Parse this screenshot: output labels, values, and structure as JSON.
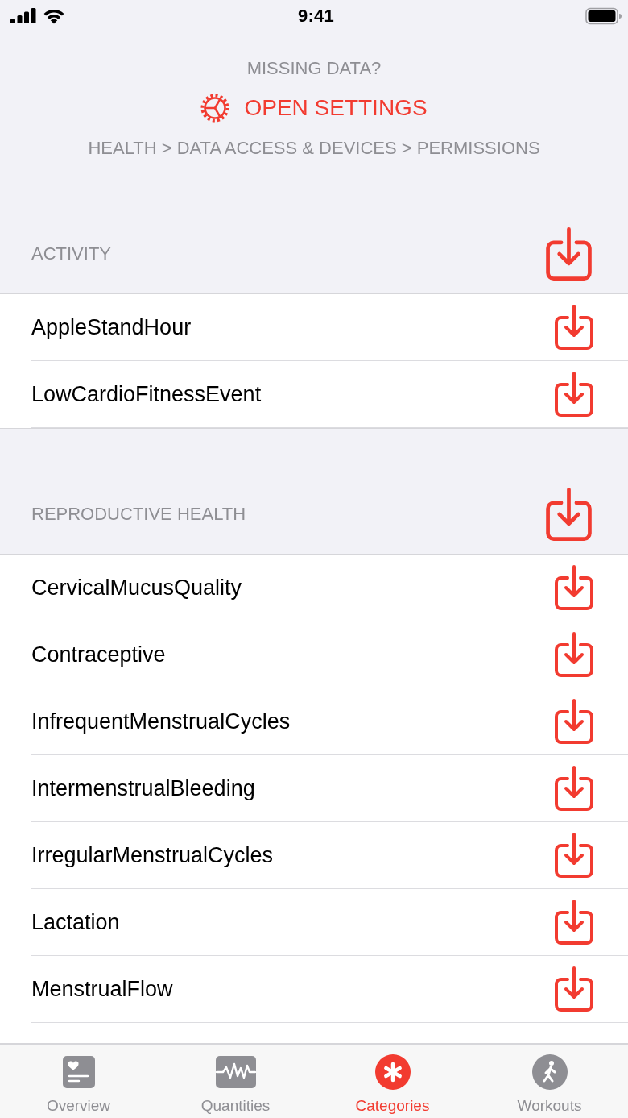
{
  "status_bar": {
    "time": "9:41"
  },
  "header": {
    "prompt": "MISSING DATA?",
    "settings_link": "OPEN SETTINGS",
    "path": "HEALTH > DATA ACCESS & DEVICES > PERMISSIONS"
  },
  "sections": [
    {
      "title": "ACTIVITY",
      "items": [
        "AppleStandHour",
        "LowCardioFitnessEvent"
      ]
    },
    {
      "title": "REPRODUCTIVE HEALTH",
      "items": [
        "CervicalMucusQuality",
        "Contraceptive",
        "InfrequentMenstrualCycles",
        "IntermenstrualBleeding",
        "IrregularMenstrualCycles",
        "Lactation",
        "MenstrualFlow"
      ]
    }
  ],
  "tab_bar": [
    {
      "label": "Overview",
      "kind": "overview",
      "selected": false
    },
    {
      "label": "Quantities",
      "kind": "quantities",
      "selected": false
    },
    {
      "label": "Categories",
      "kind": "categories",
      "selected": true
    },
    {
      "label": "Workouts",
      "kind": "workouts",
      "selected": false
    }
  ]
}
